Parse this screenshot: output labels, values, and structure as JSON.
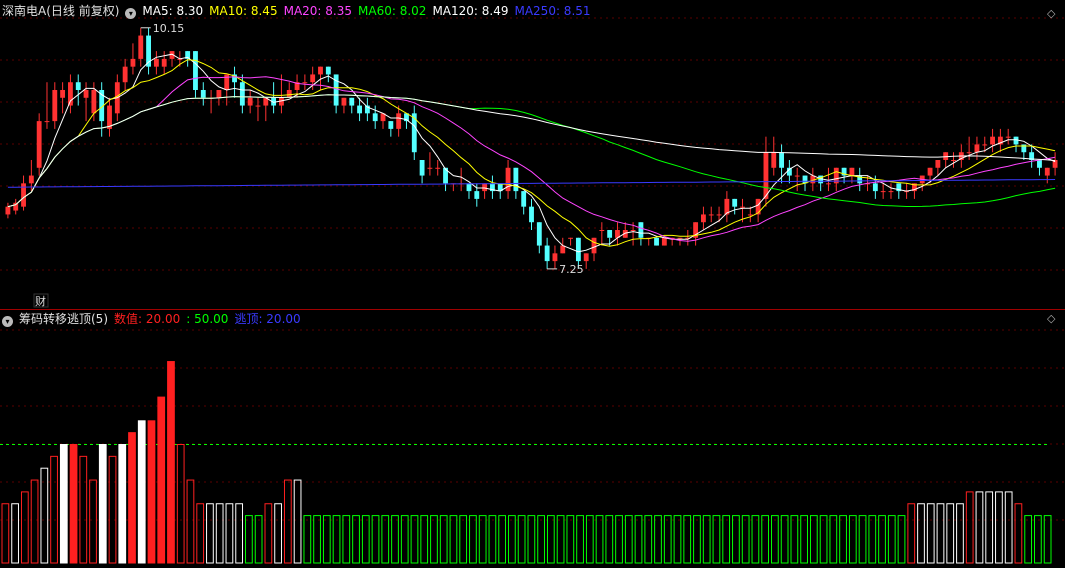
{
  "title": {
    "stock_name": "深南电A(日线 前复权)",
    "ma_items": [
      {
        "label": "MA5: 8.30",
        "color": "#ffffff"
      },
      {
        "label": "MA10: 8.45",
        "color": "#ffff00"
      },
      {
        "label": "MA20: 8.35",
        "color": "#ff44ff"
      },
      {
        "label": "MA60: 8.02",
        "color": "#00ff00"
      },
      {
        "label": "MA120: 8.49",
        "color": "#ffffff"
      },
      {
        "label": "MA250: 8.51",
        "color": "#3a3aff"
      }
    ]
  },
  "indicator": {
    "name": "筹码转移逃顶(5)",
    "items": [
      {
        "label": "数值: 20.00",
        "color": "#ff2020"
      },
      {
        "label": ": 50.00",
        "color": "#00ff00"
      },
      {
        "label": "逃顶: 20.00",
        "color": "#3a3aff"
      }
    ]
  },
  "annotations": {
    "high_label": "10.15",
    "low_label": "7.25",
    "fin_marker": "财"
  },
  "chart_data": {
    "type": "candlestick",
    "price_range": [
      7.0,
      10.6
    ],
    "high": 10.15,
    "low": 7.25,
    "colors": {
      "up": "#ff3232",
      "down": "#54ffff",
      "ma5": "#ffffff",
      "ma10": "#ffff00",
      "ma20": "#ff44ff",
      "ma60": "#00ff00",
      "ma120": "#ffffff",
      "ma250": "#3a3aff"
    },
    "candles": [
      [
        8.1,
        8.2,
        8.05,
        8.25
      ],
      [
        8.15,
        8.25,
        8.1,
        8.3
      ],
      [
        8.2,
        8.5,
        8.15,
        8.6
      ],
      [
        8.5,
        8.6,
        8.4,
        8.8
      ],
      [
        8.7,
        9.3,
        8.6,
        9.4
      ],
      [
        9.3,
        9.3,
        9.2,
        9.8
      ],
      [
        9.3,
        9.7,
        9.2,
        9.8
      ],
      [
        9.6,
        9.7,
        9.4,
        9.8
      ],
      [
        9.5,
        9.8,
        9.4,
        9.9
      ],
      [
        9.8,
        9.7,
        9.5,
        9.9
      ],
      [
        9.6,
        9.7,
        9.3,
        9.8
      ],
      [
        9.4,
        9.7,
        9.3,
        9.8
      ],
      [
        9.7,
        9.3,
        9.1,
        9.8
      ],
      [
        9.2,
        9.5,
        9.1,
        9.6
      ],
      [
        9.4,
        9.8,
        9.3,
        9.9
      ],
      [
        9.8,
        10.0,
        9.7,
        10.1
      ],
      [
        10.0,
        10.1,
        9.9,
        10.3
      ],
      [
        10.1,
        10.4,
        10.0,
        10.5
      ],
      [
        10.4,
        10.0,
        9.9,
        10.5
      ],
      [
        10.0,
        10.1,
        9.9,
        10.2
      ],
      [
        10.0,
        10.1,
        9.9,
        10.2
      ],
      [
        10.1,
        10.2,
        10.0,
        10.2
      ],
      [
        10.1,
        10.1,
        10.0,
        10.2
      ],
      [
        10.2,
        10.1,
        10.0,
        10.2
      ],
      [
        10.2,
        9.7,
        9.6,
        10.2
      ],
      [
        9.7,
        9.6,
        9.5,
        9.8
      ],
      [
        9.6,
        9.6,
        9.4,
        9.7
      ],
      [
        9.6,
        9.7,
        9.5,
        9.7
      ],
      [
        9.7,
        9.9,
        9.5,
        9.9
      ],
      [
        9.9,
        9.8,
        9.6,
        10.0
      ],
      [
        9.8,
        9.5,
        9.4,
        9.9
      ],
      [
        9.5,
        9.6,
        9.4,
        9.7
      ],
      [
        9.5,
        9.5,
        9.3,
        9.6
      ],
      [
        9.5,
        9.6,
        9.3,
        9.6
      ],
      [
        9.6,
        9.5,
        9.4,
        9.8
      ],
      [
        9.5,
        9.6,
        9.4,
        9.9
      ],
      [
        9.6,
        9.7,
        9.6,
        9.8
      ],
      [
        9.7,
        9.8,
        9.6,
        9.9
      ],
      [
        9.8,
        9.8,
        9.7,
        9.9
      ],
      [
        9.8,
        9.9,
        9.7,
        10.0
      ],
      [
        9.9,
        10.0,
        9.7,
        10.0
      ],
      [
        10.0,
        9.9,
        9.8,
        10.0
      ],
      [
        9.9,
        9.5,
        9.4,
        9.9
      ],
      [
        9.5,
        9.6,
        9.4,
        9.6
      ],
      [
        9.6,
        9.5,
        9.4,
        9.6
      ],
      [
        9.5,
        9.4,
        9.3,
        9.6
      ],
      [
        9.5,
        9.4,
        9.3,
        9.6
      ],
      [
        9.4,
        9.3,
        9.2,
        9.5
      ],
      [
        9.3,
        9.4,
        9.2,
        9.4
      ],
      [
        9.3,
        9.2,
        9.1,
        9.3
      ],
      [
        9.2,
        9.4,
        9.1,
        9.5
      ],
      [
        9.4,
        9.3,
        9.2,
        9.4
      ],
      [
        9.4,
        8.9,
        8.8,
        9.5
      ],
      [
        8.8,
        8.6,
        8.5,
        8.8
      ],
      [
        8.7,
        8.7,
        8.6,
        8.9
      ],
      [
        8.7,
        8.7,
        8.6,
        8.8
      ],
      [
        8.7,
        8.5,
        8.4,
        8.7
      ],
      [
        8.5,
        8.5,
        8.4,
        8.5
      ],
      [
        8.5,
        8.5,
        8.4,
        8.7
      ],
      [
        8.5,
        8.4,
        8.3,
        8.5
      ],
      [
        8.4,
        8.3,
        8.2,
        8.5
      ],
      [
        8.4,
        8.5,
        8.3,
        8.5
      ],
      [
        8.5,
        8.4,
        8.3,
        8.6
      ],
      [
        8.5,
        8.4,
        8.3,
        8.5
      ],
      [
        8.4,
        8.7,
        8.3,
        8.8
      ],
      [
        8.7,
        8.4,
        8.3,
        8.7
      ],
      [
        8.4,
        8.2,
        8.1,
        8.4
      ],
      [
        8.2,
        8.0,
        7.9,
        8.3
      ],
      [
        8.0,
        7.7,
        7.6,
        8.0
      ],
      [
        7.7,
        7.5,
        7.4,
        7.8
      ],
      [
        7.5,
        7.6,
        7.4,
        7.7
      ],
      [
        7.6,
        7.7,
        7.6,
        7.8
      ],
      [
        7.8,
        7.8,
        7.7,
        7.8
      ],
      [
        7.8,
        7.5,
        7.4,
        7.8
      ],
      [
        7.5,
        7.6,
        7.4,
        7.6
      ],
      [
        7.6,
        7.8,
        7.5,
        7.8
      ],
      [
        7.9,
        7.9,
        7.7,
        8.0
      ],
      [
        7.9,
        7.8,
        7.7,
        7.8
      ],
      [
        7.8,
        7.9,
        7.7,
        8.0
      ],
      [
        7.8,
        7.9,
        7.8,
        8.0
      ],
      [
        7.9,
        7.9,
        7.7,
        8.0
      ],
      [
        8.0,
        7.8,
        7.7,
        8.0
      ],
      [
        7.8,
        7.8,
        7.7,
        7.8
      ],
      [
        7.8,
        7.7,
        7.7,
        7.8
      ],
      [
        7.7,
        7.8,
        7.7,
        7.8
      ],
      [
        7.8,
        7.8,
        7.7,
        7.8
      ],
      [
        7.8,
        7.8,
        7.7,
        7.8
      ],
      [
        7.8,
        7.8,
        7.7,
        7.9
      ],
      [
        7.8,
        8.0,
        7.7,
        8.0
      ],
      [
        8.0,
        8.1,
        7.9,
        8.2
      ],
      [
        8.1,
        8.1,
        8.0,
        8.2
      ],
      [
        8.1,
        8.1,
        8.0,
        8.2
      ],
      [
        8.1,
        8.3,
        8.0,
        8.4
      ],
      [
        8.3,
        8.2,
        8.1,
        8.3
      ],
      [
        8.2,
        8.2,
        8.0,
        8.3
      ],
      [
        8.1,
        8.1,
        8.0,
        8.2
      ],
      [
        8.1,
        8.3,
        8.0,
        8.3
      ],
      [
        8.3,
        8.9,
        8.2,
        9.1
      ],
      [
        8.7,
        8.9,
        8.6,
        9.1
      ],
      [
        8.9,
        8.7,
        8.5,
        9.0
      ],
      [
        8.7,
        8.6,
        8.5,
        8.8
      ],
      [
        8.6,
        8.6,
        8.4,
        8.7
      ],
      [
        8.6,
        8.5,
        8.4,
        8.6
      ],
      [
        8.5,
        8.6,
        8.4,
        8.7
      ],
      [
        8.6,
        8.5,
        8.4,
        8.6
      ],
      [
        8.5,
        8.5,
        8.4,
        8.7
      ],
      [
        8.5,
        8.7,
        8.4,
        8.7
      ],
      [
        8.7,
        8.6,
        8.5,
        8.7
      ],
      [
        8.6,
        8.7,
        8.5,
        8.7
      ],
      [
        8.6,
        8.5,
        8.4,
        8.7
      ],
      [
        8.5,
        8.5,
        8.4,
        8.6
      ],
      [
        8.5,
        8.4,
        8.3,
        8.6
      ],
      [
        8.4,
        8.4,
        8.3,
        8.5
      ],
      [
        8.4,
        8.4,
        8.3,
        8.5
      ],
      [
        8.5,
        8.4,
        8.3,
        8.5
      ],
      [
        8.4,
        8.4,
        8.3,
        8.5
      ],
      [
        8.4,
        8.5,
        8.3,
        8.5
      ],
      [
        8.5,
        8.6,
        8.4,
        8.6
      ],
      [
        8.6,
        8.7,
        8.5,
        8.7
      ],
      [
        8.7,
        8.8,
        8.6,
        8.8
      ],
      [
        8.8,
        8.9,
        8.7,
        8.9
      ],
      [
        8.8,
        8.8,
        8.7,
        8.9
      ],
      [
        8.8,
        8.9,
        8.7,
        9.0
      ],
      [
        8.9,
        8.9,
        8.8,
        9.1
      ],
      [
        8.9,
        9.0,
        8.8,
        9.1
      ],
      [
        9.0,
        9.0,
        8.9,
        9.1
      ],
      [
        9.0,
        9.1,
        8.9,
        9.2
      ],
      [
        9.0,
        9.1,
        8.9,
        9.2
      ],
      [
        9.1,
        9.1,
        9.0,
        9.2
      ],
      [
        9.1,
        9.0,
        8.9,
        9.1
      ],
      [
        9.0,
        8.9,
        8.8,
        9.0
      ],
      [
        8.9,
        8.8,
        8.7,
        9.0
      ],
      [
        8.8,
        8.7,
        8.6,
        8.8
      ],
      [
        8.6,
        8.7,
        8.5,
        8.7
      ],
      [
        8.7,
        8.8,
        8.6,
        8.9
      ]
    ],
    "indicator": {
      "value_20": 20.0,
      "value_50": 50.0,
      "ylim": [
        0,
        100
      ],
      "bars": [
        [
          25,
          "r"
        ],
        [
          25,
          "w"
        ],
        [
          30,
          "r"
        ],
        [
          35,
          "r"
        ],
        [
          40,
          "w"
        ],
        [
          45,
          "r"
        ],
        [
          50,
          "w"
        ],
        [
          50,
          "r"
        ],
        [
          45,
          "r"
        ],
        [
          35,
          "r"
        ],
        [
          50,
          "w"
        ],
        [
          45,
          "r"
        ],
        [
          50,
          "w"
        ],
        [
          55,
          "r"
        ],
        [
          60,
          "w"
        ],
        [
          60,
          "r"
        ],
        [
          70,
          "r"
        ],
        [
          85,
          "r"
        ],
        [
          50,
          "r"
        ],
        [
          35,
          "r"
        ],
        [
          25,
          "r"
        ],
        [
          25,
          "w"
        ],
        [
          25,
          "w"
        ],
        [
          25,
          "w"
        ],
        [
          25,
          "w"
        ],
        [
          20,
          "g"
        ],
        [
          20,
          "g"
        ],
        [
          25,
          "r"
        ],
        [
          25,
          "w"
        ],
        [
          35,
          "r"
        ],
        [
          35,
          "w"
        ],
        [
          20,
          "g"
        ]
      ],
      "rest_color": "g",
      "rest_value": 20,
      "tail": [
        [
          25,
          "r"
        ],
        [
          25,
          "w"
        ],
        [
          25,
          "w"
        ],
        [
          25,
          "w"
        ],
        [
          25,
          "w"
        ],
        [
          25,
          "w"
        ],
        [
          30,
          "r"
        ],
        [
          30,
          "w"
        ],
        [
          30,
          "w"
        ],
        [
          30,
          "w"
        ],
        [
          30,
          "w"
        ],
        [
          25,
          "r"
        ],
        [
          20,
          "g"
        ],
        [
          20,
          "g"
        ],
        [
          20,
          "g"
        ]
      ]
    }
  }
}
